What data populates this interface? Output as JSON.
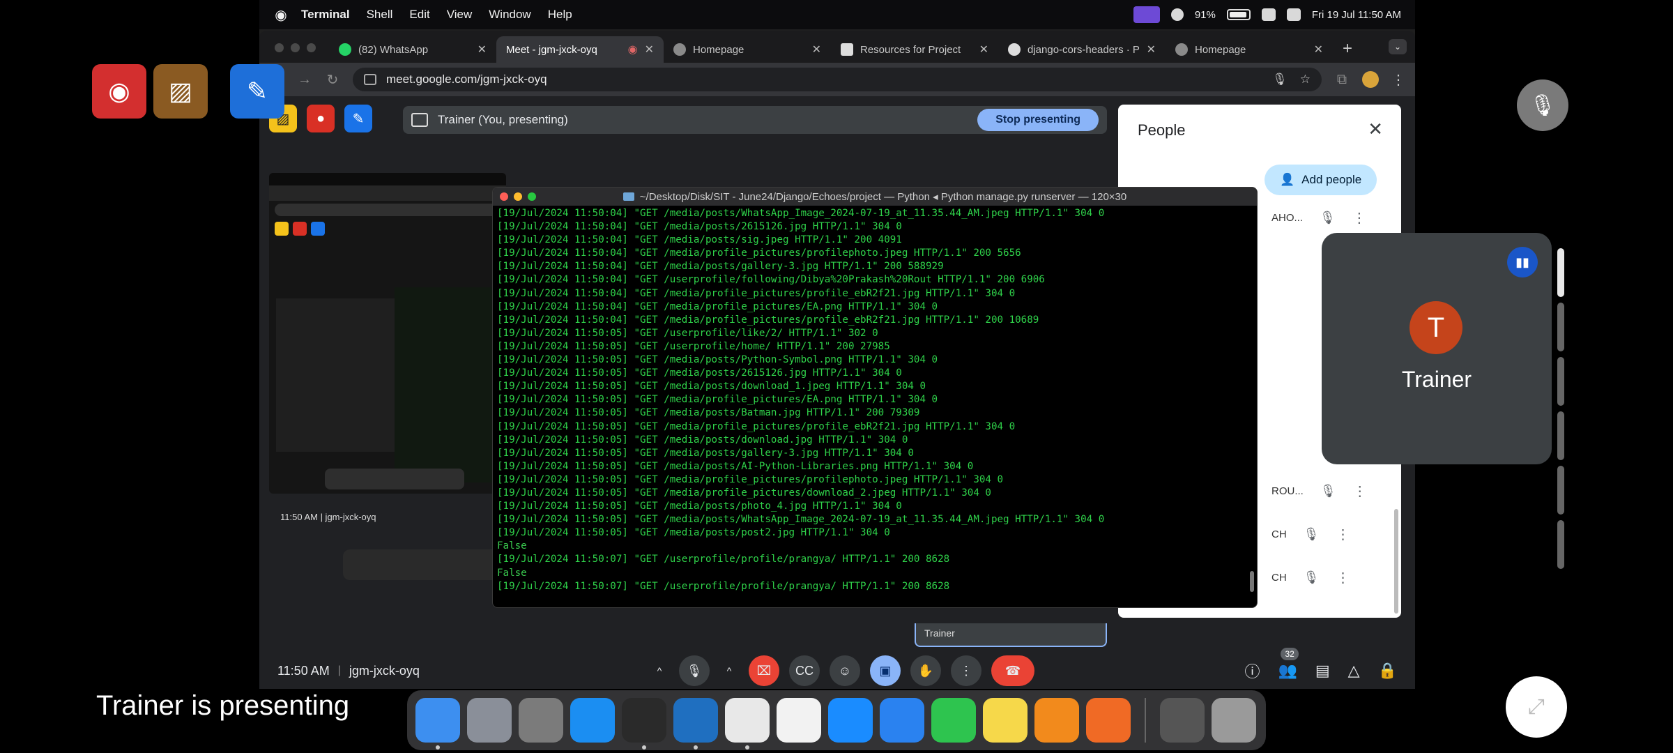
{
  "menubar": {
    "app": "Terminal",
    "items": [
      "Shell",
      "Edit",
      "View",
      "Window",
      "Help"
    ],
    "battery": "91%",
    "datetime": "Fri 19 Jul  11:50 AM"
  },
  "browser": {
    "tabs": [
      {
        "label": "(82) WhatsApp"
      },
      {
        "label": "Meet - jgm-jxck-oyq"
      },
      {
        "label": "Homepage"
      },
      {
        "label": "Resources for Project"
      },
      {
        "label": "django-cors-headers · P"
      },
      {
        "label": "Homepage"
      }
    ],
    "url": "meet.google.com/jgm-jxck-oyq"
  },
  "meet": {
    "presenting_label": "Trainer (You, presenting)",
    "stop_presenting": "Stop presenting",
    "time": "11:50 AM",
    "code": "jgm-jxck-oyq",
    "participant_count": "32",
    "nested_caption": "11:50 AM  |  jgm-jxck-oyq"
  },
  "terminal": {
    "title": "~/Desktop/Disk/SIT - June24/Django/Echoes/project — Python ◂ Python manage.py runserver — 120×30",
    "lines": [
      "[19/Jul/2024 11:50:04] \"GET /media/posts/WhatsApp_Image_2024-07-19_at_11.35.44_AM.jpeg HTTP/1.1\" 304 0",
      "[19/Jul/2024 11:50:04] \"GET /media/posts/2615126.jpg HTTP/1.1\" 304 0",
      "[19/Jul/2024 11:50:04] \"GET /media/posts/sig.jpeg HTTP/1.1\" 200 4091",
      "[19/Jul/2024 11:50:04] \"GET /media/profile_pictures/profilephoto.jpeg HTTP/1.1\" 200 5656",
      "[19/Jul/2024 11:50:04] \"GET /media/posts/gallery-3.jpg HTTP/1.1\" 200 588929",
      "[19/Jul/2024 11:50:04] \"GET /userprofile/following/Dibya%20Prakash%20Rout HTTP/1.1\" 200 6906",
      "[19/Jul/2024 11:50:04] \"GET /media/profile_pictures/profile_ebR2f21.jpg HTTP/1.1\" 304 0",
      "[19/Jul/2024 11:50:04] \"GET /media/profile_pictures/EA.png HTTP/1.1\" 304 0",
      "[19/Jul/2024 11:50:04] \"GET /media/profile_pictures/profile_ebR2f21.jpg HTTP/1.1\" 200 10689",
      "[19/Jul/2024 11:50:05] \"GET /userprofile/like/2/ HTTP/1.1\" 302 0",
      "[19/Jul/2024 11:50:05] \"GET /userprofile/home/ HTTP/1.1\" 200 27985",
      "[19/Jul/2024 11:50:05] \"GET /media/posts/Python-Symbol.png HTTP/1.1\" 304 0",
      "[19/Jul/2024 11:50:05] \"GET /media/posts/2615126.jpg HTTP/1.1\" 304 0",
      "[19/Jul/2024 11:50:05] \"GET /media/posts/download_1.jpeg HTTP/1.1\" 304 0",
      "[19/Jul/2024 11:50:05] \"GET /media/profile_pictures/EA.png HTTP/1.1\" 304 0",
      "[19/Jul/2024 11:50:05] \"GET /media/posts/Batman.jpg HTTP/1.1\" 200 79309",
      "[19/Jul/2024 11:50:05] \"GET /media/profile_pictures/profile_ebR2f21.jpg HTTP/1.1\" 304 0",
      "[19/Jul/2024 11:50:05] \"GET /media/posts/download.jpg HTTP/1.1\" 304 0",
      "[19/Jul/2024 11:50:05] \"GET /media/posts/gallery-3.jpg HTTP/1.1\" 304 0",
      "[19/Jul/2024 11:50:05] \"GET /media/posts/AI-Python-Libraries.png HTTP/1.1\" 304 0",
      "[19/Jul/2024 11:50:05] \"GET /media/profile_pictures/profilephoto.jpeg HTTP/1.1\" 304 0",
      "[19/Jul/2024 11:50:05] \"GET /media/profile_pictures/download_2.jpeg HTTP/1.1\" 304 0",
      "[19/Jul/2024 11:50:05] \"GET /media/posts/photo_4.jpg HTTP/1.1\" 304 0",
      "[19/Jul/2024 11:50:05] \"GET /media/posts/WhatsApp_Image_2024-07-19_at_11.35.44_AM.jpeg HTTP/1.1\" 304 0",
      "[19/Jul/2024 11:50:05] \"GET /media/posts/post2.jpg HTTP/1.1\" 304 0",
      "False",
      "[19/Jul/2024 11:50:07] \"GET /userprofile/profile/prangya/ HTTP/1.1\" 200 8628",
      "False",
      "[19/Jul/2024 11:50:07] \"GET /userprofile/profile/prangya/ HTTP/1.1\" 200 8628"
    ]
  },
  "people_panel": {
    "title": "People",
    "add_people": "Add people",
    "rows": [
      {
        "fragment": "AHO..."
      },
      {
        "fragment": "ROU..."
      },
      {
        "fragment": "CH"
      },
      {
        "fragment": "CH"
      }
    ],
    "trainer_tile": "Trainer"
  },
  "overlay": {
    "self_name": "Trainer",
    "self_initial": "T",
    "presenting_text": "Trainer is presenting"
  },
  "dock": {
    "apps": [
      {
        "icon": "finder-icon",
        "color": "#3d8ff0"
      },
      {
        "icon": "launchpad-icon",
        "color": "#8a8f99"
      },
      {
        "icon": "system-settings-icon",
        "color": "#7b7b7b"
      },
      {
        "icon": "app-store-icon",
        "color": "#1b8ef2"
      },
      {
        "icon": "terminal-icon",
        "color": "#2a2a2a"
      },
      {
        "icon": "vscode-icon",
        "color": "#1f6fc0"
      },
      {
        "icon": "chrome-icon",
        "color": "#e8e8e8"
      },
      {
        "icon": "photos-icon",
        "color": "#f2f2f2"
      },
      {
        "icon": "safari-icon",
        "color": "#1a8cff"
      },
      {
        "icon": "mail-icon",
        "color": "#2a82f0"
      },
      {
        "icon": "facetime-icon",
        "color": "#2ec44f"
      },
      {
        "icon": "notes-icon",
        "color": "#f6d84a"
      },
      {
        "icon": "pages-icon",
        "color": "#f28a1c"
      },
      {
        "icon": "sketch-pen-icon",
        "color": "#f06a25"
      }
    ]
  }
}
